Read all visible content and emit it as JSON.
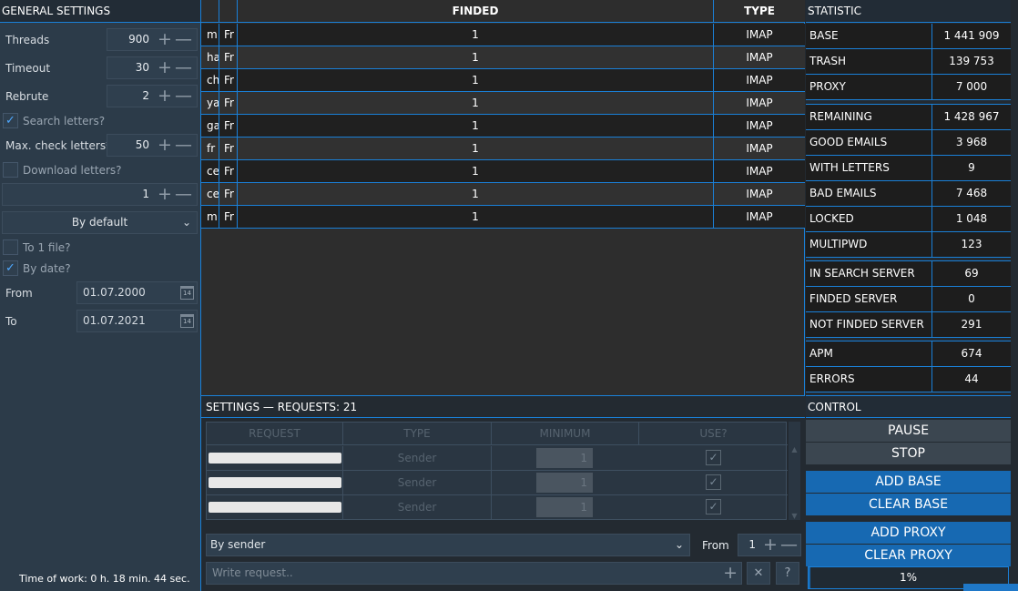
{
  "general": {
    "title": "GENERAL SETTINGS",
    "threads": {
      "label": "Threads",
      "value": "900"
    },
    "timeout": {
      "label": "Timeout",
      "value": "30"
    },
    "rebrute": {
      "label": "Rebrute",
      "value": "2"
    },
    "search_letters": {
      "label": "Search letters?",
      "checked": true
    },
    "max_check": {
      "label": "Max. check letters*",
      "value": "50"
    },
    "download_letters": {
      "label": "Download letters?",
      "checked": false
    },
    "download_count": {
      "value": "1"
    },
    "order_select": "By default",
    "to_one_file": {
      "label": "To 1 file?",
      "checked": false
    },
    "by_date": {
      "label": "By date?",
      "checked": true
    },
    "from": {
      "label": "From",
      "value": "01.07.2000"
    },
    "to": {
      "label": "To",
      "value": "01.07.2021"
    },
    "calendar_glyph": "14",
    "time_of_work": "Time of work: 0 h. 18 min. 44 sec."
  },
  "finded_table": {
    "headers": {
      "c1": "",
      "c2": "",
      "finded": "FINDED",
      "type": "TYPE"
    },
    "rows": [
      {
        "c1": "m",
        "c2": "Fr",
        "finded": "1",
        "type": "IMAP"
      },
      {
        "c1": "ha",
        "c2": "Fr",
        "finded": "1",
        "type": "IMAP"
      },
      {
        "c1": "ch",
        "c2": "Fr",
        "finded": "1",
        "type": "IMAP"
      },
      {
        "c1": "ya",
        "c2": "Fr",
        "finded": "1",
        "type": "IMAP"
      },
      {
        "c1": "ga",
        "c2": "Fr",
        "finded": "1",
        "type": "IMAP"
      },
      {
        "c1": "fr",
        "c2": "Fr",
        "finded": "1",
        "type": "IMAP"
      },
      {
        "c1": "ce",
        "c2": "Fr",
        "finded": "1",
        "type": "IMAP"
      },
      {
        "c1": "ce",
        "c2": "Fr",
        "finded": "1",
        "type": "IMAP"
      },
      {
        "c1": "m",
        "c2": "Fr",
        "finded": "1",
        "type": "IMAP"
      }
    ]
  },
  "requests": {
    "title": "SETTINGS — REQUESTS: 21",
    "headers": {
      "request": "REQUEST",
      "type": "TYPE",
      "minimum": "MINIMUM",
      "use": "USE?"
    },
    "rows": [
      {
        "type": "Sender",
        "minimum": "1",
        "use": true
      },
      {
        "type": "Sender",
        "minimum": "1",
        "use": true
      },
      {
        "type": "Sender",
        "minimum": "1",
        "use": true
      }
    ],
    "filter_select": "By sender",
    "from_label": "From",
    "from_value": "1",
    "write_placeholder": "Write request..",
    "clear_glyph": "✕",
    "help_glyph": "?"
  },
  "statistic": {
    "title": "STATISTIC",
    "group1": [
      {
        "label": "BASE",
        "value": "1 441 909"
      },
      {
        "label": "TRASH",
        "value": "139 753"
      },
      {
        "label": "PROXY",
        "value": "7 000"
      }
    ],
    "group2": [
      {
        "label": "REMAINING",
        "value": "1 428 967"
      },
      {
        "label": "GOOD EMAILS",
        "value": "3 968"
      },
      {
        "label": "WITH LETTERS",
        "value": "9"
      },
      {
        "label": "BAD EMAILS",
        "value": "7 468"
      },
      {
        "label": "LOCKED",
        "value": "1 048"
      },
      {
        "label": "MULTIPWD",
        "value": "123"
      }
    ],
    "group3": [
      {
        "label": "IN SEARCH SERVER",
        "value": "69"
      },
      {
        "label": "FINDED SERVER",
        "value": "0"
      },
      {
        "label": "NOT FINDED SERVER",
        "value": "291"
      }
    ],
    "group4": [
      {
        "label": "APM",
        "value": "674"
      },
      {
        "label": "ERRORS",
        "value": "44"
      }
    ]
  },
  "control": {
    "title": "CONTROL",
    "pause": "PAUSE",
    "stop": "STOP",
    "add_base": "ADD BASE",
    "clear_base": "CLEAR BASE",
    "add_proxy": "ADD PROXY",
    "clear_proxy": "CLEAR PROXY",
    "progress_percent": 1,
    "progress_label": "1%"
  },
  "glyphs": {
    "plus": "+",
    "minus": "—",
    "check": "✓",
    "caret": "⌄"
  },
  "colors": {
    "accent": "#1a80d8",
    "button_blue": "#1769b2",
    "panel": "#2c3b49"
  }
}
